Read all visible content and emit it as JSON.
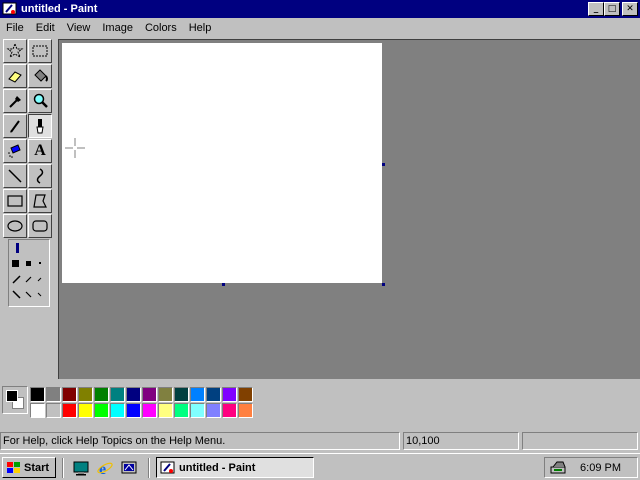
{
  "window": {
    "title": "untitled - Paint",
    "buttons": {
      "minimize": "_",
      "maximize": "□",
      "close": "✕"
    }
  },
  "menu": [
    "File",
    "Edit",
    "View",
    "Image",
    "Colors",
    "Help"
  ],
  "tools": [
    {
      "name": "free-form-select",
      "icon": "star-select-icon"
    },
    {
      "name": "select",
      "icon": "rect-select-icon"
    },
    {
      "name": "eraser",
      "icon": "eraser-icon"
    },
    {
      "name": "fill-with-color",
      "icon": "paint-bucket-icon"
    },
    {
      "name": "pick-color",
      "icon": "eyedropper-icon"
    },
    {
      "name": "magnifier",
      "icon": "magnifier-icon"
    },
    {
      "name": "pencil",
      "icon": "pencil-icon",
      "active": true
    },
    {
      "name": "brush",
      "icon": "brush-icon"
    },
    {
      "name": "airbrush",
      "icon": "airbrush-icon"
    },
    {
      "name": "text",
      "icon": "text-icon",
      "label": "A"
    },
    {
      "name": "line",
      "icon": "line-icon"
    },
    {
      "name": "curve",
      "icon": "curve-icon"
    },
    {
      "name": "rectangle",
      "icon": "rectangle-icon"
    },
    {
      "name": "polygon",
      "icon": "polygon-icon"
    },
    {
      "name": "ellipse",
      "icon": "ellipse-icon"
    },
    {
      "name": "rounded-rectangle",
      "icon": "rounded-rect-icon"
    }
  ],
  "palette": {
    "foreground": "#000000",
    "background": "#ffffff",
    "top_row": [
      "#000000",
      "#808080",
      "#800000",
      "#808000",
      "#008000",
      "#008080",
      "#000080",
      "#800080",
      "#808040",
      "#004040",
      "#0080ff",
      "#004080",
      "#8000ff",
      "#804000"
    ],
    "bottom_row": [
      "#ffffff",
      "#c0c0c0",
      "#ff0000",
      "#ffff00",
      "#00ff00",
      "#00ffff",
      "#0000ff",
      "#ff00ff",
      "#ffff80",
      "#00ff80",
      "#80ffff",
      "#8080ff",
      "#ff0080",
      "#ff8040"
    ]
  },
  "status": {
    "help_text": "For Help, click Help Topics on the Help Menu.",
    "coords": "10,100",
    "size": ""
  },
  "taskbar": {
    "start_label": "Start",
    "quick_launch": [
      "desktop-icon",
      "internet-explorer-icon",
      "channels-icon"
    ],
    "tasks": [
      {
        "label": "untitled - Paint",
        "active": true
      }
    ],
    "clock": "6:09 PM"
  }
}
